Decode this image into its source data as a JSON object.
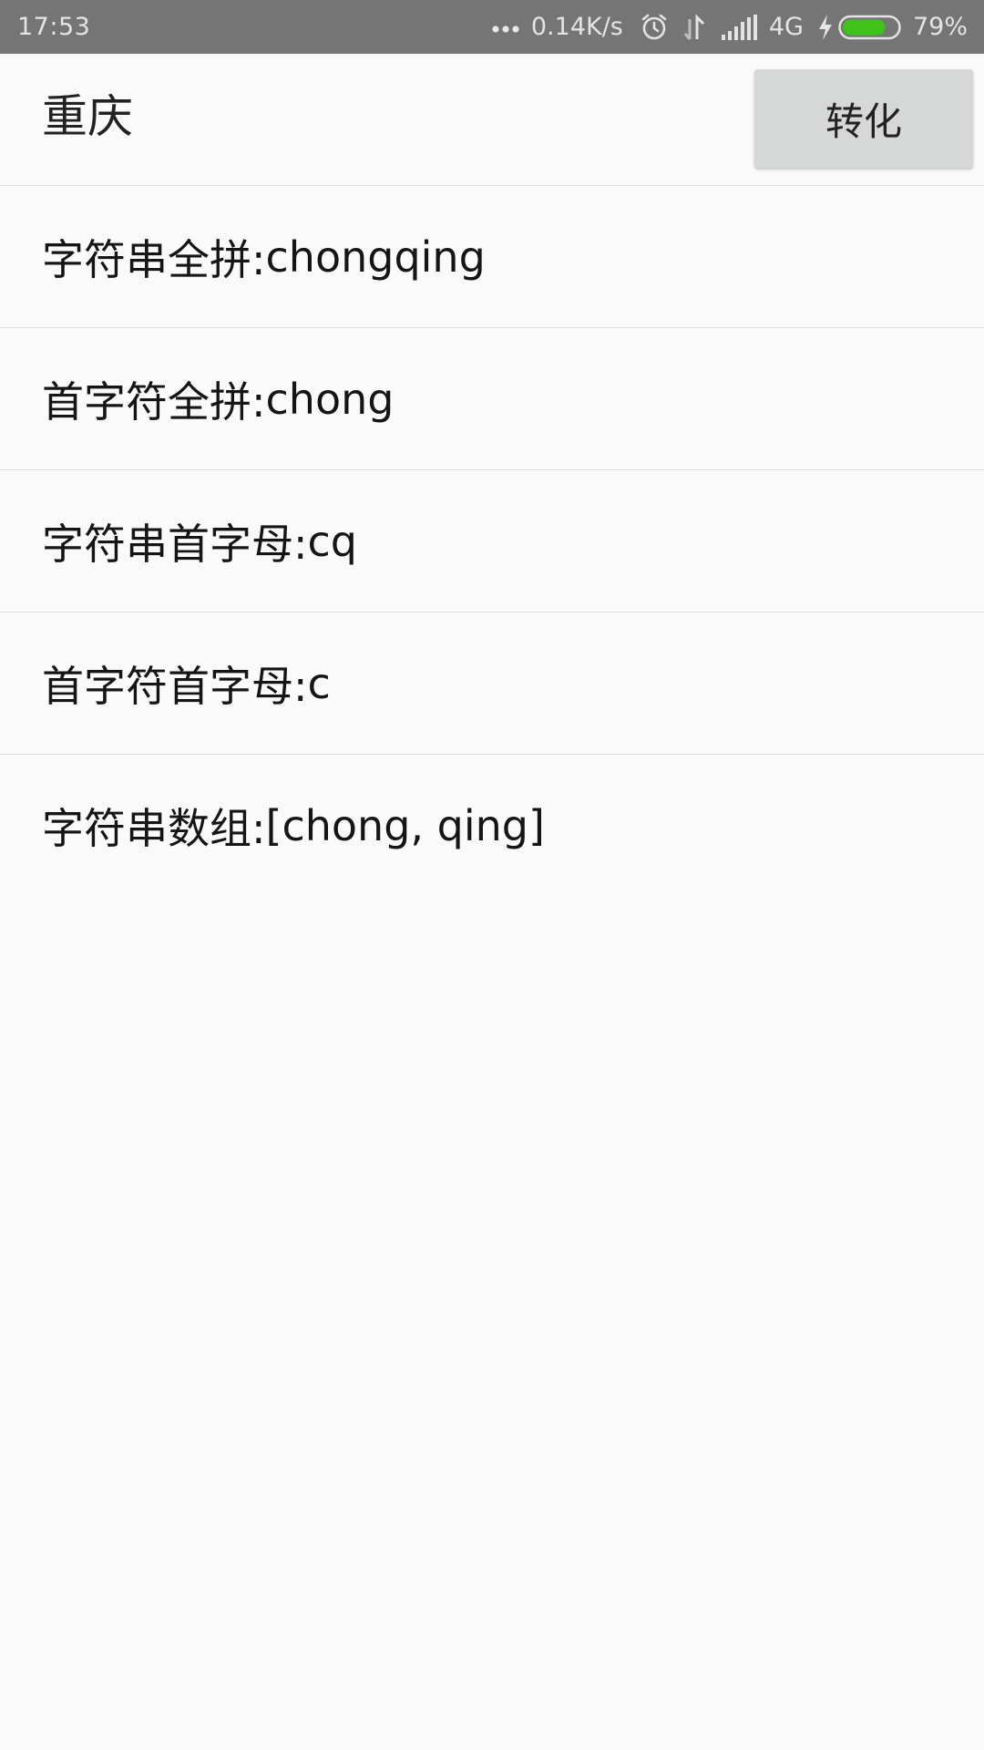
{
  "status_bar": {
    "time": "17:53",
    "net_speed": "0.14K/s",
    "network_type": "4G",
    "battery_percent": "79%",
    "battery_level": 0.79,
    "battery_color": "#3fc31a",
    "icons": [
      "more-dots-icon",
      "alarm-icon",
      "data-arrows-icon",
      "signal-icon",
      "charging-icon",
      "battery-icon"
    ]
  },
  "input": {
    "value": "重庆"
  },
  "convert_button": {
    "label": "转化"
  },
  "results": [
    {
      "label": "字符串全拼:",
      "value": "chongqing"
    },
    {
      "label": "首字符全拼:",
      "value": "chong"
    },
    {
      "label": "字符串首字母:",
      "value": "cq"
    },
    {
      "label": "首字符首字母:",
      "value": "c"
    },
    {
      "label": "字符串数组:",
      "value": "[chong, qing]"
    }
  ]
}
